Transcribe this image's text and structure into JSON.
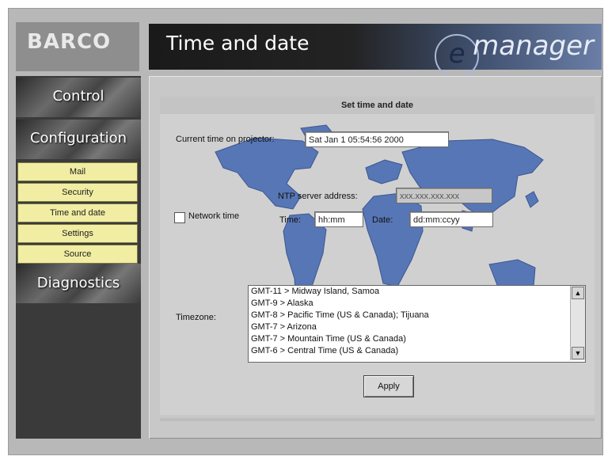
{
  "brand": {
    "logo_text": "BARCO",
    "product_text": "manager",
    "product_e": "e"
  },
  "header": {
    "title": "Time and date"
  },
  "sidebar": {
    "sections": [
      {
        "label": "Control"
      },
      {
        "label": "Configuration"
      },
      {
        "label": "Diagnostics"
      }
    ],
    "submenu": [
      {
        "label": "Mail"
      },
      {
        "label": "Security"
      },
      {
        "label": "Time and date"
      },
      {
        "label": "Settings"
      },
      {
        "label": "Source"
      }
    ]
  },
  "form": {
    "heading": "Set time and date",
    "current_time_label": "Current time on projector:",
    "current_time_value": "Sat Jan  1 05:54:56 2000",
    "network_time_label": "Network time",
    "ntp_label": "NTP server address:",
    "ntp_value": "xxx.xxx.xxx.xxx",
    "time_label": "Time:",
    "time_value": "hh:mm",
    "date_label": "Date:",
    "date_value": "dd:mm:ccyy",
    "timezone_label": "Timezone:",
    "timezones": [
      "GMT-11 > Midway Island, Samoa",
      "GMT-9 > Alaska",
      "GMT-8 > Pacific Time (US & Canada); Tijuana",
      "GMT-7 > Arizona",
      "GMT-7 > Mountain Time (US & Canada)",
      "GMT-6 > Central Time (US & Canada)"
    ],
    "apply_label": "Apply"
  },
  "colors": {
    "submenu_bg": "#f1eda3",
    "map_land": "#5776b5",
    "panel_bg": "#d0d0d0"
  }
}
